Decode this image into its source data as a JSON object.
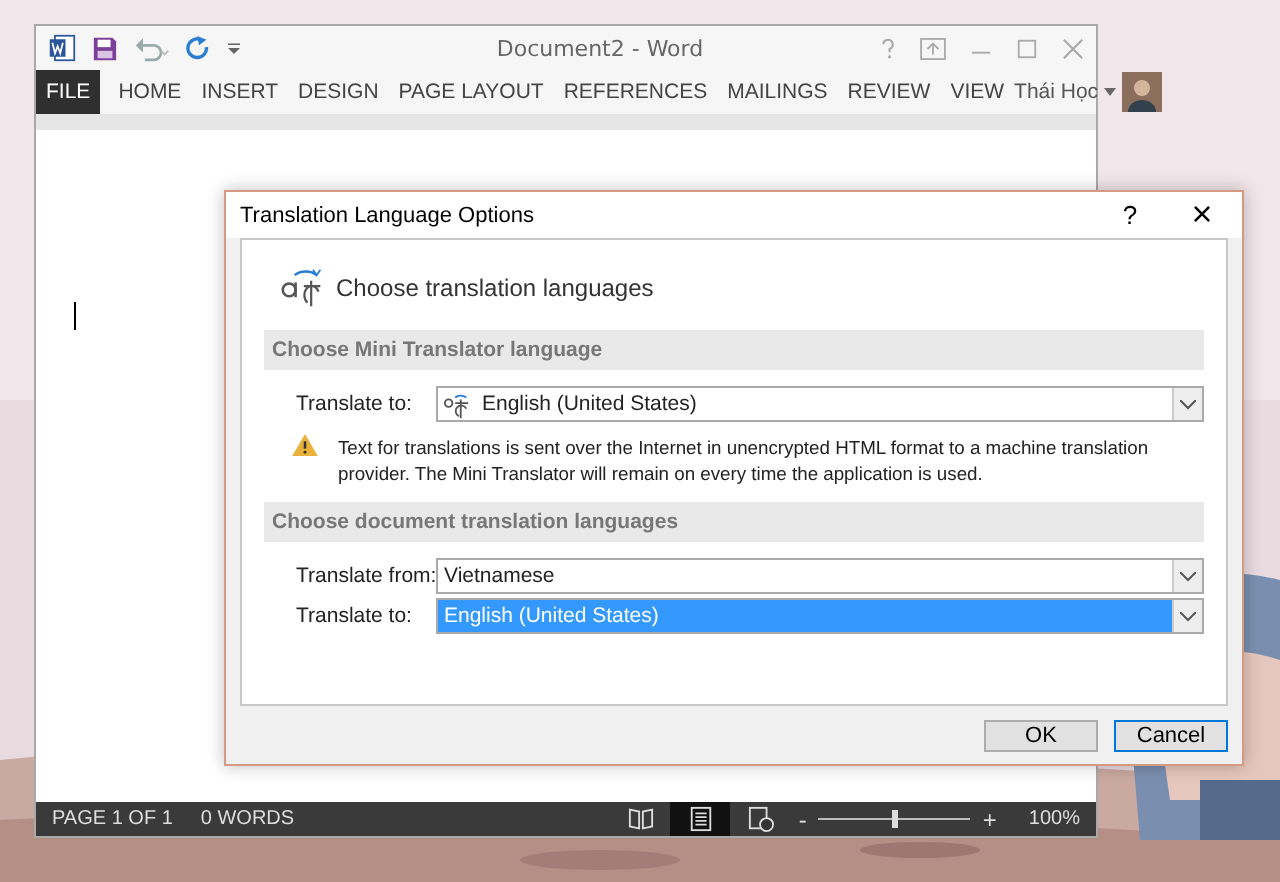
{
  "word_window": {
    "title": "Document2 - Word",
    "ribbon_tabs": [
      {
        "label": "FILE",
        "kind": "file"
      },
      {
        "label": "HOME",
        "kind": "tab"
      },
      {
        "label": "INSERT",
        "kind": "tab"
      },
      {
        "label": "DESIGN",
        "kind": "tab"
      },
      {
        "label": "PAGE LAYOUT",
        "kind": "tab"
      },
      {
        "label": "REFERENCES",
        "kind": "tab"
      },
      {
        "label": "MAILINGS",
        "kind": "tab"
      },
      {
        "label": "REVIEW",
        "kind": "tab"
      },
      {
        "label": "VIEW",
        "kind": "tab"
      }
    ],
    "account": "Thái Học",
    "status_bar": {
      "page": "PAGE 1 OF 1",
      "words": "0 WORDS",
      "views": [
        {
          "kind": "read",
          "selected": false
        },
        {
          "kind": "print",
          "selected": true
        },
        {
          "kind": "web",
          "selected": false
        }
      ],
      "zoom_out": "-",
      "zoom_in": "+",
      "zoom": {
        "level": 0.5
      },
      "zoom_reading": "100%"
    }
  },
  "dialog": {
    "title": "Translation Language Options",
    "help": "?",
    "close": "×",
    "heading": "Choose translation languages",
    "sections": [
      {
        "title": "Choose Mini Translator language",
        "fields": [
          {
            "label": "Translate to:",
            "value": "English (United States)",
            "kind": "icon",
            "focused": false
          }
        ],
        "warning": "Text for translations is sent over the Internet in unencrypted HTML format to a machine translation provider. The Mini Translator will remain on every time the application is used."
      },
      {
        "title": "Choose document translation languages",
        "fields": [
          {
            "label": "Translate from:",
            "value": "Vietnamese",
            "kind": "plain",
            "focused": false
          },
          {
            "label": "Translate to:",
            "value": "English (United States)",
            "kind": "plain",
            "focused": true
          }
        ]
      }
    ],
    "buttons": [
      {
        "label": "OK",
        "default": false
      },
      {
        "label": "Cancel",
        "default": true
      }
    ]
  }
}
